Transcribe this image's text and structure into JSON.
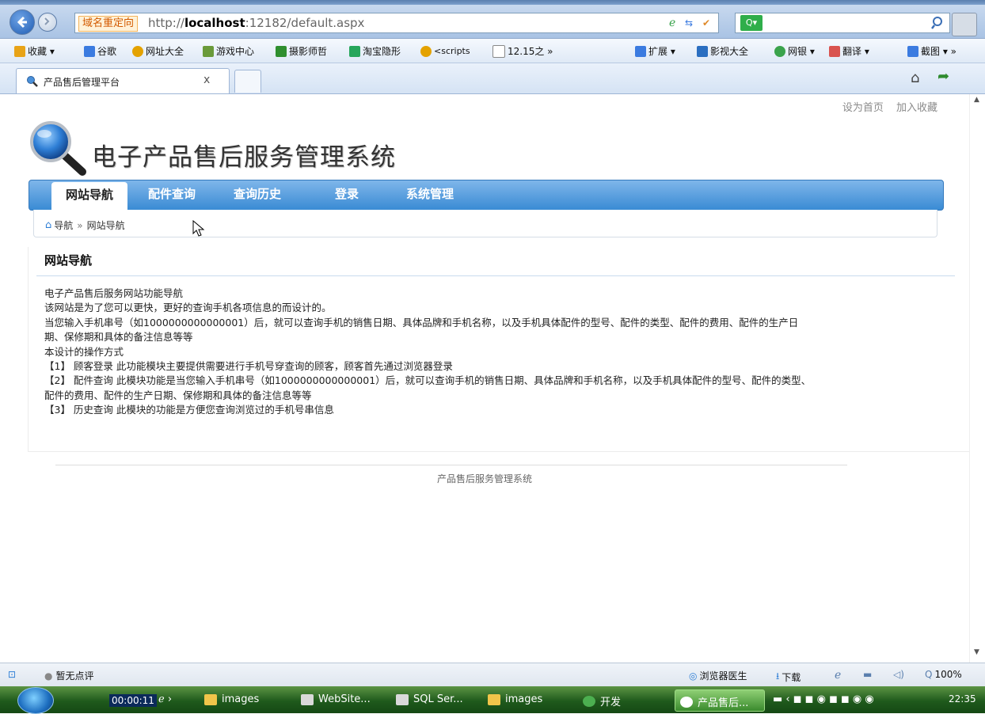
{
  "browser": {
    "redirect_tag": "域名重定向",
    "url_prefix": "http://",
    "url_host": "localhost",
    "url_rest": ":12182/default.aspx",
    "favorites": [
      {
        "label": "收藏 ▾",
        "color": "#e8a317",
        "icon": "star-icon"
      },
      {
        "label": "谷歌",
        "color": "#3b7be0",
        "icon": "google-icon"
      },
      {
        "label": "网址大全",
        "color": "#e4a200",
        "icon": "globe-icon"
      },
      {
        "label": "游戏中心",
        "color": "#6a9a3a",
        "icon": "game-icon"
      },
      {
        "label": "摄影师哲",
        "color": "#2f8f2f",
        "icon": "photo-icon"
      },
      {
        "label": "淘宝隐形",
        "color": "#26a65b",
        "icon": "search-icon"
      },
      {
        "label": "<scripts",
        "color": "#e4a200",
        "icon": "globe-icon"
      },
      {
        "label": "12.15之 »",
        "color": "#ffffff",
        "icon": "page-icon"
      },
      {
        "label": "扩展 ▾",
        "color": "#3b7be0",
        "icon": "extension-icon"
      },
      {
        "label": "影视大全",
        "color": "#2b6fc1",
        "icon": "video-icon"
      },
      {
        "label": "网银 ▾",
        "color": "#3aa34c",
        "icon": "bank-icon"
      },
      {
        "label": "翻译 ▾",
        "color": "#d9534f",
        "icon": "translate-icon"
      },
      {
        "label": "截图 ▾ »",
        "color": "#3b7be0",
        "icon": "screenshot-icon"
      }
    ],
    "tab_title": "产品售后管理平台",
    "tab_close": "x"
  },
  "page": {
    "top_links": [
      "设为首页",
      "加入收藏"
    ],
    "site_title": "电子产品售后服务管理系统",
    "nav": [
      "网站导航",
      "配件查询",
      "查询历史",
      "登录",
      "系统管理"
    ],
    "breadcrumb": {
      "home": "导航",
      "sep": "»",
      "current": "网站导航"
    },
    "section_title": "网站导航",
    "lines": [
      "电子产品售后服务网站功能导航",
      "该网站是为了您可以更快，更好的查询手机各项信息的而设计的。",
      "当您输入手机串号（如1000000000000001）后，就可以查询手机的销售日期、具体品牌和手机名称，以及手机具体配件的型号、配件的类型、配件的费用、配件的生产日",
      "期、保修期和具体的备注信息等等",
      "本设计的操作方式",
      "【1】 顾客登录 此功能模块主要提供需要进行手机号穿查询的顾客，顾客首先通过浏览器登录",
      "【2】 配件查询 此模块功能是当您输入手机串号（如1000000000000001）后，就可以查询手机的销售日期、具体品牌和手机名称，以及手机具体配件的型号、配件的类型、",
      "配件的费用、配件的生产日期、保修期和具体的备注信息等等",
      "【3】 历史查询 此模块的功能是方便您查询浏览过的手机号串信息"
    ],
    "footer": "产品售后服务管理系统"
  },
  "statusbar": {
    "comment": "暂无点评",
    "doctor": "浏览器医生",
    "download": "下载",
    "zoom": "100%"
  },
  "taskbar": {
    "timer": "00:00:11",
    "items": [
      "images",
      "WebSite...",
      "SQL Ser...",
      "images",
      "开发"
    ],
    "active": "产品售后...",
    "clock": "22:35"
  }
}
